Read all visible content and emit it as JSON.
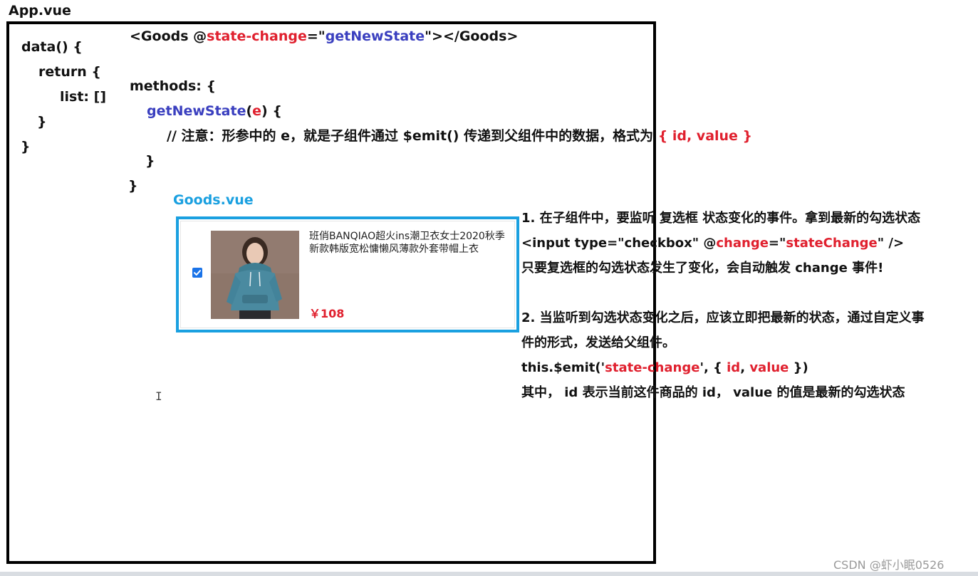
{
  "app": {
    "title": "App.vue",
    "data_block": [
      "data() {",
      "return {",
      "list: []",
      "}",
      "}"
    ],
    "template_line": {
      "open": "<Goods @",
      "event": "state-change",
      "eq": "=\"",
      "handler": "getNewState",
      "close": "\"></Goods>"
    },
    "methods": {
      "line1": "methods: {",
      "fn_name": "getNewState",
      "fn_paren_open": "(",
      "fn_param": "e",
      "fn_paren_close": ") {",
      "comment": "// 注意：形参中的 e，就是子组件通过 $emit() 传递到父组件中的数据，格式为 ",
      "comment_format": "{ id, value }",
      "close_inner": "}",
      "close_outer": "}"
    }
  },
  "goods": {
    "title": "Goods.vue",
    "checked": true,
    "name": "班俏BANQIAO超火ins潮卫衣女士2020秋季新款韩版宽松慵懒风薄款外套带帽上衣",
    "price": "￥108"
  },
  "notes": {
    "step1": "1. 在子组件中，要监听 复选框 状态变化的事件。拿到最新的勾选状态",
    "input_line": {
      "p1": "<input type=\"checkbox\" @",
      "event": "change",
      "eq": "=\"",
      "handler": "stateChange",
      "p2": "\" />"
    },
    "step1_desc": "只要复选框的勾选状态发生了变化，会自动触发 change 事件!",
    "step2_a": "2. 当监听到勾选状态变化之后，应该立即把最新的状态，通过自定义事",
    "step2_b": "件的形式，发送给父组件。",
    "emit_line": {
      "p1": "this.$emit('",
      "event": "state-change",
      "p2": "', { ",
      "id": "id",
      "comma": ", ",
      "value": "value",
      "p3": " })"
    },
    "step2_desc": "其中， id 表示当前这件商品的 id， value 的值是最新的勾选状态"
  },
  "watermark": "CSDN @虾小眠0526",
  "colors": {
    "red": "#e0202e",
    "blue": "#3a3fbf",
    "cyan": "#1aa0e0",
    "checkbox": "#1a73e8"
  }
}
